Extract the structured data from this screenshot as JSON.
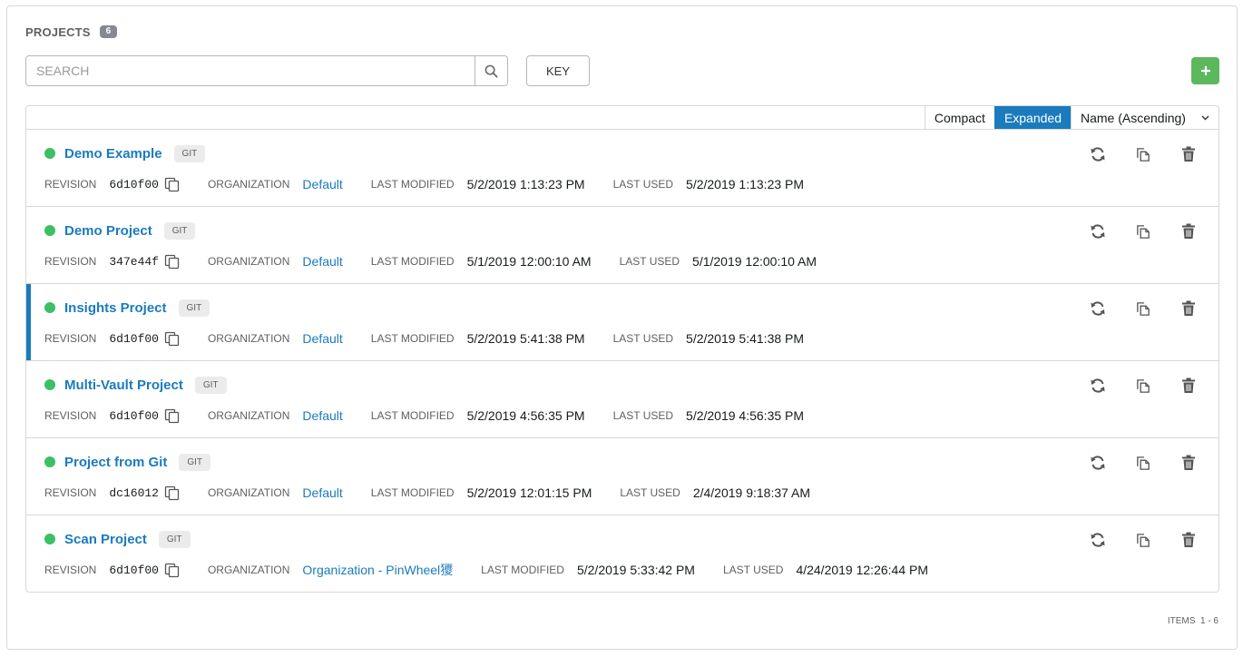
{
  "header": {
    "title": "PROJECTS",
    "count": "6"
  },
  "search": {
    "placeholder": "SEARCH",
    "value": ""
  },
  "toolbar": {
    "key_label": "KEY",
    "add_label": "+"
  },
  "view": {
    "compact_label": "Compact",
    "expanded_label": "Expanded",
    "sort_label": "Name (Ascending)"
  },
  "labels": {
    "revision": "REVISION",
    "organization": "ORGANIZATION",
    "last_modified": "LAST MODIFIED",
    "last_used": "LAST USED"
  },
  "projects": [
    {
      "name": "Demo Example",
      "scm": "GIT",
      "revision": "6d10f00",
      "organization": "Default",
      "last_modified": "5/2/2019 1:13:23 PM",
      "last_used": "5/2/2019 1:13:23 PM",
      "status_color": "#3dbf63",
      "selected": false
    },
    {
      "name": "Demo Project",
      "scm": "GIT",
      "revision": "347e44f",
      "organization": "Default",
      "last_modified": "5/1/2019 12:00:10 AM",
      "last_used": "5/1/2019 12:00:10 AM",
      "status_color": "#3dbf63",
      "selected": false
    },
    {
      "name": "Insights Project",
      "scm": "GIT",
      "revision": "6d10f00",
      "organization": "Default",
      "last_modified": "5/2/2019 5:41:38 PM",
      "last_used": "5/2/2019 5:41:38 PM",
      "status_color": "#3dbf63",
      "selected": true
    },
    {
      "name": "Multi-Vault Project",
      "scm": "GIT",
      "revision": "6d10f00",
      "organization": "Default",
      "last_modified": "5/2/2019 4:56:35 PM",
      "last_used": "5/2/2019 4:56:35 PM",
      "status_color": "#3dbf63",
      "selected": false
    },
    {
      "name": "Project from Git",
      "scm": "GIT",
      "revision": "dc16012",
      "organization": "Default",
      "last_modified": "5/2/2019 12:01:15 PM",
      "last_used": "2/4/2019 9:18:37 AM",
      "status_color": "#3dbf63",
      "selected": false
    },
    {
      "name": "Scan Project",
      "scm": "GIT",
      "revision": "6d10f00",
      "organization": "Organization - PinWheel獿",
      "last_modified": "5/2/2019 5:33:42 PM",
      "last_used": "4/24/2019 12:26:44 PM",
      "status_color": "#3dbf63",
      "selected": false
    }
  ],
  "pager": {
    "items_label": "ITEMS",
    "range": "1 - 6"
  },
  "icons": {
    "search": "search-icon",
    "add": "plus-icon",
    "copy": "copy-icon",
    "sync": "sync-icon",
    "duplicate": "duplicate-icon",
    "delete": "trash-icon",
    "sort": "chevron-down-icon"
  },
  "colors": {
    "accent": "#1a7bbd",
    "success": "#3dbf63",
    "add_button": "#5cb85c"
  }
}
